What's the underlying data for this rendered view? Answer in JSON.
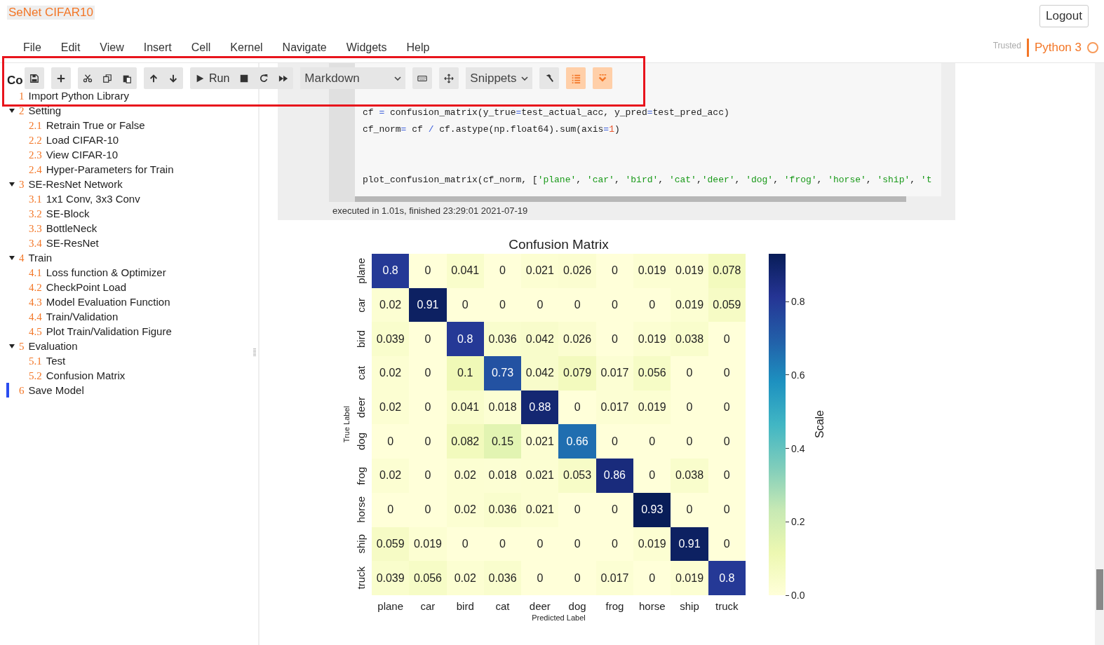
{
  "header": {
    "title": "SeNet CIFAR10",
    "logout": "Logout"
  },
  "menu": [
    "File",
    "Edit",
    "View",
    "Insert",
    "Cell",
    "Kernel",
    "Navigate",
    "Widgets",
    "Help"
  ],
  "kernel": {
    "trusted": "Trusted",
    "name": "Python 3",
    "busy": false
  },
  "toolbar": {
    "groups": [
      {
        "kind": "buttons",
        "items": [
          {
            "active": false
          }
        ]
      },
      {
        "kind": "buttons",
        "items": [
          {
            "active": false
          }
        ]
      },
      {
        "kind": "buttons",
        "items": [
          {
            "active": false
          },
          {
            "active": false
          },
          {
            "active": false
          }
        ]
      },
      {
        "kind": "buttons",
        "items": [
          {
            "active": false
          },
          {
            "active": false
          }
        ]
      },
      {
        "kind": "buttons",
        "items": [
          {
            "label": "Run",
            "active": false
          },
          {
            "active": false
          },
          {
            "active": false
          },
          {
            "active": false
          }
        ]
      },
      {
        "kind": "select",
        "label": "Markdown"
      },
      {
        "kind": "buttons",
        "items": [
          {
            "active": false
          }
        ]
      },
      {
        "kind": "buttons",
        "items": [
          {
            "active": false
          }
        ]
      },
      {
        "kind": "select",
        "label": "Snippets"
      },
      {
        "kind": "buttons",
        "items": [
          {
            "active": false
          }
        ]
      },
      {
        "kind": "buttons",
        "items": [
          {
            "active": true
          }
        ]
      },
      {
        "kind": "buttons",
        "items": [
          {
            "active": true
          }
        ]
      }
    ]
  },
  "sidebar": {
    "title": "Co",
    "items": [
      {
        "number": "1",
        "label": "Import Python Library",
        "selected": false
      },
      {
        "number": "2",
        "label": "Setting",
        "selected": false,
        "expanded": true,
        "children": [
          {
            "number": "2.1",
            "label": "Retrain True or False",
            "selected": false
          },
          {
            "number": "2.2",
            "label": "Load CIFAR-10",
            "selected": false
          },
          {
            "number": "2.3",
            "label": "View CIFAR-10",
            "selected": false
          },
          {
            "number": "2.4",
            "label": "Hyper-Parameters for Train",
            "selected": false
          }
        ]
      },
      {
        "number": "3",
        "label": "SE-ResNet Network",
        "selected": false,
        "expanded": true,
        "children": [
          {
            "number": "3.1",
            "label": "1x1 Conv, 3x3 Conv",
            "selected": false
          },
          {
            "number": "3.2",
            "label": "SE-Block",
            "selected": false
          },
          {
            "number": "3.3",
            "label": "BottleNeck",
            "selected": false
          },
          {
            "number": "3.4",
            "label": "SE-ResNet",
            "selected": false
          }
        ]
      },
      {
        "number": "4",
        "label": "Train",
        "selected": false,
        "expanded": true,
        "children": [
          {
            "number": "4.1",
            "label": "Loss function & Optimizer",
            "selected": false
          },
          {
            "number": "4.2",
            "label": "CheckPoint Load",
            "selected": false
          },
          {
            "number": "4.3",
            "label": "Model Evaluation Function",
            "selected": false
          },
          {
            "number": "4.4",
            "label": "Train/Validation",
            "selected": false
          },
          {
            "number": "4.5",
            "label": "Plot Train/Validation Figure",
            "selected": false
          }
        ]
      },
      {
        "number": "5",
        "label": "Evaluation",
        "selected": false,
        "expanded": true,
        "children": [
          {
            "number": "5.1",
            "label": "Test",
            "selected": false
          },
          {
            "number": "5.2",
            "label": "Confusion Matrix",
            "selected": false
          }
        ]
      },
      {
        "number": "6",
        "label": "Save Model",
        "selected": true
      }
    ]
  },
  "code_cell": {
    "lines": [
      "cf = confusion_matrix(y_true=test_actual_acc, y_pred=test_pred_acc)",
      "cf_norm= cf / cf.astype(np.float64).sum(axis=1)",
      "plot_confusion_matrix(cf_norm, ['plane', 'car', 'bird', 'cat','deer', 'dog', 'frog', 'horse', 'ship', 't"
    ],
    "status": "executed in 1.01s, finished 23:29:01 2021-07-19"
  },
  "confusion_matrix": {
    "title": "Confusion Matrix",
    "xlabel": "Predicted Label",
    "ylabel": "True Label",
    "x_labels": [
      "plane",
      "car",
      "bird",
      "cat",
      "deer",
      "dog",
      "frog",
      "horse",
      "ship",
      "truck"
    ],
    "rows": [
      {
        "label": "plane",
        "cells": [
          "0.8",
          "0",
          "0.041",
          "0",
          "0.021",
          "0.026",
          "0",
          "0.019",
          "0.019",
          "0.078"
        ]
      },
      {
        "label": "car",
        "cells": [
          "0.02",
          "0.91",
          "0",
          "0",
          "0",
          "0",
          "0",
          "0",
          "0.019",
          "0.059"
        ]
      },
      {
        "label": "bird",
        "cells": [
          "0.039",
          "0",
          "0.8",
          "0.036",
          "0.042",
          "0.026",
          "0",
          "0.019",
          "0.038",
          "0"
        ]
      },
      {
        "label": "cat",
        "cells": [
          "0.02",
          "0",
          "0.1",
          "0.73",
          "0.042",
          "0.079",
          "0.017",
          "0.056",
          "0",
          "0"
        ]
      },
      {
        "label": "deer",
        "cells": [
          "0.02",
          "0",
          "0.041",
          "0.018",
          "0.88",
          "0",
          "0.017",
          "0.019",
          "0",
          "0"
        ]
      },
      {
        "label": "dog",
        "cells": [
          "0",
          "0",
          "0.082",
          "0.15",
          "0.021",
          "0.66",
          "0",
          "0",
          "0",
          "0"
        ]
      },
      {
        "label": "frog",
        "cells": [
          "0.02",
          "0",
          "0.02",
          "0.018",
          "0.021",
          "0.053",
          "0.86",
          "0",
          "0.038",
          "0"
        ]
      },
      {
        "label": "horse",
        "cells": [
          "0",
          "0",
          "0.02",
          "0.036",
          "0.021",
          "0",
          "0",
          "0.93",
          "0",
          "0"
        ]
      },
      {
        "label": "ship",
        "cells": [
          "0.059",
          "0.019",
          "0",
          "0",
          "0",
          "0",
          "0",
          "0.019",
          "0.91",
          "0"
        ]
      },
      {
        "label": "truck",
        "cells": [
          "0.039",
          "0.056",
          "0.02",
          "0.036",
          "0",
          "0",
          "0.017",
          "0",
          "0.019",
          "0.8"
        ]
      }
    ],
    "colorbar": {
      "label": "Scale",
      "ticks": [
        "0.8",
        "0.6",
        "0.4",
        "0.2",
        "0.0"
      ]
    }
  }
}
